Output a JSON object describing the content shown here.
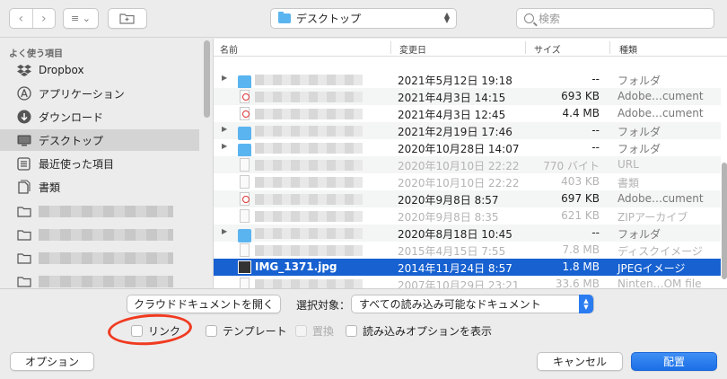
{
  "toolbar": {
    "back": "‹",
    "forward": "›",
    "view_mode": "≡ ⌄",
    "new_folder": "+",
    "location": "デスクトップ",
    "search_placeholder": "検索"
  },
  "sidebar": {
    "section_title": "よく使う項目",
    "items": [
      {
        "label": "Dropbox",
        "icon": "dropbox-icon"
      },
      {
        "label": "アプリケーション",
        "icon": "applications-icon"
      },
      {
        "label": "ダウンロード",
        "icon": "download-icon"
      },
      {
        "label": "デスクトップ",
        "icon": "desktop-icon",
        "selected": true
      },
      {
        "label": "最近使った項目",
        "icon": "recents-icon"
      },
      {
        "label": "書類",
        "icon": "documents-icon"
      }
    ]
  },
  "filelist": {
    "columns": {
      "name": "名前",
      "date": "変更日",
      "size": "サイズ",
      "kind": "種類"
    },
    "rows": [
      {
        "type": "folder",
        "date": "2021年5月12日 19:18",
        "size": "--",
        "kind": "フォルダ"
      },
      {
        "type": "pdf",
        "date": "2021年4月3日 14:15",
        "size": "693 KB",
        "kind": "Adobe…cument"
      },
      {
        "type": "pdf",
        "date": "2021年4月3日 12:45",
        "size": "4.4 MB",
        "kind": "Adobe…cument"
      },
      {
        "type": "folder",
        "date": "2021年2月19日 17:46",
        "size": "--",
        "kind": "フォルダ"
      },
      {
        "type": "folder",
        "date": "2020年10月28日 14:07",
        "size": "--",
        "kind": "フォルダ"
      },
      {
        "type": "doc",
        "date": "2020年10月10日 22:22",
        "size": "770 バイト",
        "kind": "URL",
        "dim": true
      },
      {
        "type": "doc",
        "date": "2020年10月10日 22:22",
        "size": "403 KB",
        "kind": "書類",
        "dim": true
      },
      {
        "type": "pdf",
        "date": "2020年9月8日 8:57",
        "size": "697 KB",
        "kind": "Adobe…cument"
      },
      {
        "type": "doc",
        "date": "2020年9月8日 8:35",
        "size": "621 KB",
        "kind": "ZIPアーカイブ",
        "dim": true
      },
      {
        "type": "folder",
        "date": "2020年8月18日 10:45",
        "size": "--",
        "kind": "フォルダ"
      },
      {
        "type": "doc",
        "date": "2015年4月15日 7:55",
        "size": "7.8 MB",
        "kind": "ディスクイメージ",
        "dim": true
      },
      {
        "type": "img",
        "name": "IMG_1371.jpg",
        "date": "2014年11月24日 8:57",
        "size": "1.8 MB",
        "kind": "JPEGイメージ",
        "selected": true
      },
      {
        "type": "doc",
        "date": "2007年10月29日 23:21",
        "size": "33.6 MB",
        "kind": "Ninten…OM file",
        "dim": true
      }
    ]
  },
  "bottom": {
    "cloud_button": "クラウドドキュメントを開く",
    "filter_label": "選択対象：",
    "filter_value": "すべての読み込み可能なドキュメント",
    "checkbox_link": "リンク",
    "checkbox_template": "テンプレート",
    "checkbox_replace": "置換",
    "checkbox_import_options": "読み込みオプションを表示",
    "options_button": "オプション",
    "cancel_button": "キャンセル",
    "place_button": "配置"
  },
  "colors": {
    "accent": "#1761d1",
    "folder": "#5ab4f0",
    "annotation": "#f03a20"
  }
}
